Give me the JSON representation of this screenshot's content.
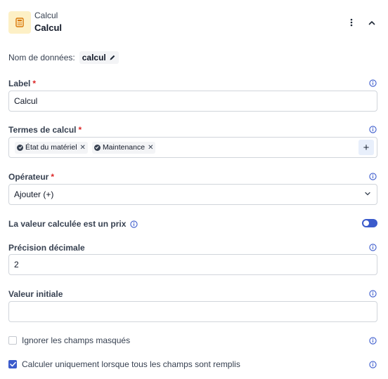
{
  "header": {
    "type_label": "Calcul",
    "field_name": "Calcul",
    "icon": "calculator-icon",
    "tile_color": "#fdf0c6"
  },
  "data_name": {
    "label": "Nom de données:",
    "value": "calcul"
  },
  "label_field": {
    "label": "Label",
    "required_mark": "*",
    "value": "Calcul"
  },
  "terms": {
    "label": "Termes de calcul",
    "required_mark": "*",
    "tags": [
      "État du matériel",
      "Maintenance"
    ],
    "add_label": "+"
  },
  "operator": {
    "label": "Opérateur",
    "required_mark": "*",
    "value": "Ajouter (+)"
  },
  "price_toggle": {
    "label": "La valeur calculée est un prix",
    "enabled": true
  },
  "precision": {
    "label": "Précision décimale",
    "value": "2"
  },
  "initial_value": {
    "label": "Valeur initiale",
    "value": ""
  },
  "ignore_hidden": {
    "label": "Ignorer les champs masqués",
    "checked": false
  },
  "compute_when_filled": {
    "label": "Calculer uniquement lorsque tous les champs sont remplis",
    "checked": true
  },
  "colors": {
    "accent": "#3b5bcc",
    "required": "#dc2626",
    "info_icon": "#3b5bcc"
  }
}
